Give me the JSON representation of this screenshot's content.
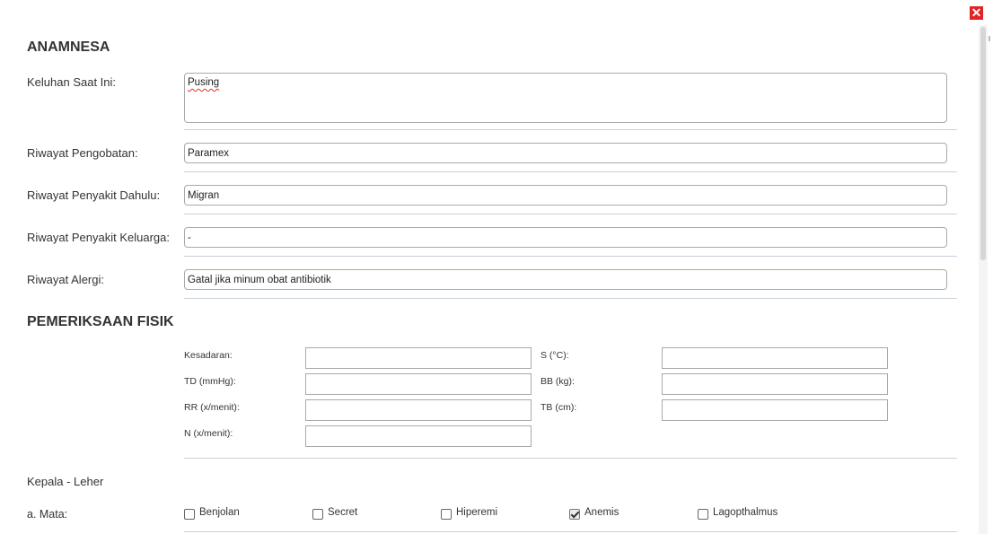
{
  "close_label": "✕",
  "anamnesa": {
    "title": "ANAMNESA",
    "fields": [
      {
        "label": "Keluhan Saat Ini:",
        "value": "Pusing"
      },
      {
        "label": "Riwayat Pengobatan:",
        "value": "Paramex"
      },
      {
        "label": "Riwayat Penyakit Dahulu:",
        "value": "Migran"
      },
      {
        "label": "Riwayat Penyakit Keluarga:",
        "value": "-"
      },
      {
        "label": "Riwayat Alergi:",
        "value": "Gatal jika minum obat antibiotik"
      }
    ]
  },
  "pemeriksaan": {
    "title": "PEMERIKSAAN FISIK",
    "left": [
      {
        "label": "Kesadaran:",
        "value": ""
      },
      {
        "label": "TD (mmHg):",
        "value": ""
      },
      {
        "label": "RR (x/menit):",
        "value": ""
      },
      {
        "label": "N (x/menit):",
        "value": ""
      }
    ],
    "right": [
      {
        "label": "S (°C):",
        "value": ""
      },
      {
        "label": "BB (kg):",
        "value": ""
      },
      {
        "label": "TB (cm):",
        "value": ""
      }
    ]
  },
  "kepala_leher": {
    "title": "Kepala - Leher",
    "mata_label": "a. Mata:",
    "mata_options": [
      {
        "label": "Benjolan",
        "checked": false
      },
      {
        "label": "Secret",
        "checked": false
      },
      {
        "label": "Hiperemi",
        "checked": false
      },
      {
        "label": "Anemis",
        "checked": true
      },
      {
        "label": "Lagopthalmus",
        "checked": false
      }
    ]
  }
}
